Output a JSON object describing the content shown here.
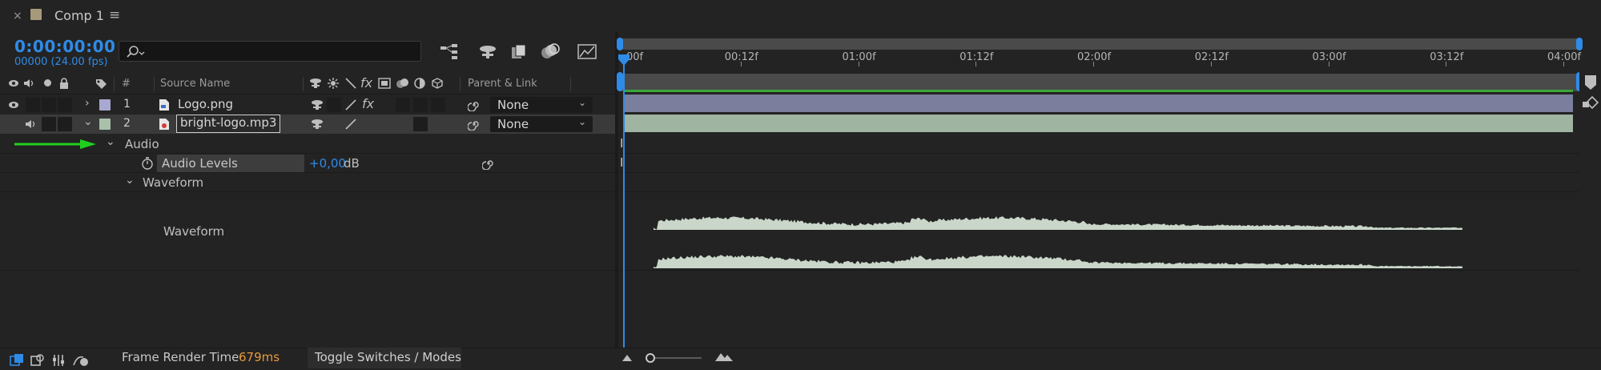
{
  "tab": {
    "title": "Comp 1",
    "close": "×",
    "menu": "≡",
    "color": "#a79a7c"
  },
  "header": {
    "timecode": "0:00:00:00",
    "fps": "00000 (24.00 fps)",
    "search_placeholder": ""
  },
  "columns": {
    "number": "#",
    "source_name": "Source Name",
    "parent_link": "Parent & Link",
    "fx": "fx"
  },
  "layers": [
    {
      "number": "1",
      "name": "Logo.png",
      "parent": "None",
      "color": "#a9a8d0",
      "fx": "fx"
    },
    {
      "number": "2",
      "name": "bright-logo.mp3",
      "parent": "None",
      "color": "#a9c0aa"
    }
  ],
  "audio": {
    "group": "Audio",
    "levels_label": "Audio Levels",
    "levels_value": "+0,00",
    "levels_unit": "dB",
    "waveform_group": "Waveform",
    "waveform_label": "Waveform"
  },
  "ruler": {
    "ticks": [
      "00f",
      "00:12f",
      "01:00f",
      "01:12f",
      "02:00f",
      "02:12f",
      "03:00f",
      "03:12f",
      "04:00f"
    ]
  },
  "bottom": {
    "frame_render_label": "Frame Render Time",
    "frame_render_value": "679ms",
    "toggle_label": "Toggle Switches / Modes"
  },
  "colors": {
    "accent": "#2f8be8",
    "render_time": "#e89a3c",
    "work_area": "#3aa63a",
    "annotation_arrow": "#1fd11f"
  }
}
